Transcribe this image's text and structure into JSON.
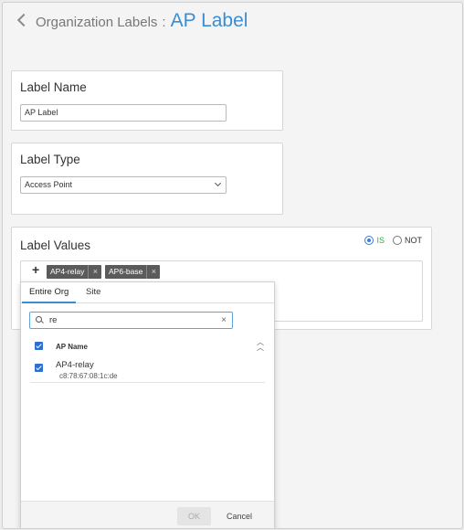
{
  "header": {
    "parent": "Organization Labels",
    "separator": ":",
    "title": "AP Label"
  },
  "label_name": {
    "title": "Label Name",
    "value": "AP Label"
  },
  "label_type": {
    "title": "Label Type",
    "selected": "Access Point"
  },
  "label_values": {
    "title": "Label Values",
    "radio": [
      {
        "label": "IS",
        "selected": true
      },
      {
        "label": "NOT",
        "selected": false
      }
    ],
    "add_symbol": "+",
    "chips": [
      {
        "label": "AP4-relay",
        "remove": "×"
      },
      {
        "label": "AP6-base",
        "remove": "×"
      }
    ]
  },
  "dropdown": {
    "tabs": [
      {
        "label": "Entire Org",
        "active": true
      },
      {
        "label": "Site",
        "active": false
      }
    ],
    "search": {
      "value": "re",
      "clear": "×"
    },
    "column_header": "AP Name",
    "rows": [
      {
        "name": "AP4-relay",
        "mac": "c8:78:67:08:1c:de",
        "checked": true
      }
    ],
    "ok_label": "OK",
    "cancel_label": "Cancel"
  },
  "colors": {
    "accent": "#3b8dd0",
    "checkbox": "#2f6fd0",
    "is_label": "#3aa94a"
  }
}
